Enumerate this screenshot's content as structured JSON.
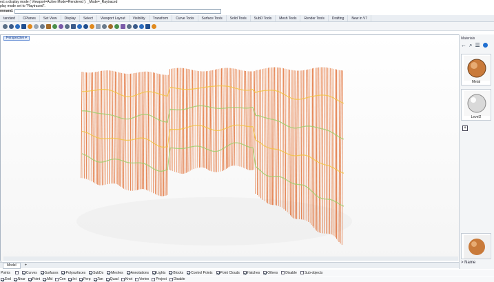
{
  "command_history": [
    "ect a display mode ( Viewport=Active  Mode=Rendered ): _Mode=_Raytraced",
    "play mode set to \"Raytraced\"."
  ],
  "command_prompt": "mmand:",
  "toolbar_tabs": [
    "tandard",
    "CPlanes",
    "Set View",
    "Display",
    "Select",
    "Viewport Layout",
    "Visibility",
    "Transform",
    "Curve Tools",
    "Surface Tools",
    "Solid Tools",
    "SubD Tools",
    "Mesh Tools",
    "Render Tools",
    "Drafting",
    "New in V7"
  ],
  "toolbar_icons": [
    "new-file-icon",
    "open-file-icon",
    "save-icon",
    "print-icon",
    "import-icon",
    "cut-icon",
    "copy-icon",
    "paste-icon",
    "undo-icon",
    "redo-icon",
    "pan-icon",
    "rotate-view-icon",
    "zoom-icon",
    "zoom-extents-icon",
    "zoom-window-icon",
    "camera-icon",
    "shade-icon",
    "render-icon",
    "sun-icon",
    "light-icon",
    "layer-icon",
    "material-icon",
    "display-icon",
    "osnap-icon",
    "options-icon"
  ],
  "viewport": {
    "label": "Perspective",
    "display_mode": "Raytraced",
    "colors": {
      "stroke_main": "#e0692d",
      "stroke_light": "#ec9a6c",
      "highlight_green": "#9bcf6a",
      "highlight_yellow": "#f2c441"
    }
  },
  "materials_panel": {
    "title": "Materials",
    "tools": [
      "back-arrow-icon",
      "search-icon",
      "list-view-icon",
      "help-icon"
    ],
    "items": [
      {
        "name": "Metal",
        "color": "#c97a3a"
      },
      {
        "name": "Level2",
        "color": "#d9d9d9"
      }
    ],
    "add_label": "+",
    "name_label": "> Name"
  },
  "model_tabs": [
    "Model",
    "+"
  ],
  "osnap_toggles": [
    {
      "label": "Points",
      "checked": false
    },
    {
      "label": "Curves",
      "checked": true
    },
    {
      "label": "Surfaces",
      "checked": true
    },
    {
      "label": "Polysurfaces",
      "checked": true
    },
    {
      "label": "SubDs",
      "checked": true
    },
    {
      "label": "Meshes",
      "checked": true
    },
    {
      "label": "Annotations",
      "checked": true
    },
    {
      "label": "Lights",
      "checked": true
    },
    {
      "label": "Blocks",
      "checked": true
    },
    {
      "label": "Control Points",
      "checked": true
    },
    {
      "label": "Point Clouds",
      "checked": true
    },
    {
      "label": "Hatches",
      "checked": true
    },
    {
      "label": "Others",
      "checked": true
    },
    {
      "label": "Disable",
      "checked": false
    },
    {
      "label": "Sub-objects",
      "checked": false
    }
  ],
  "snap_toggles": [
    {
      "label": "End",
      "checked": true
    },
    {
      "label": "Near",
      "checked": true
    },
    {
      "label": "Point",
      "checked": true
    },
    {
      "label": "Mid",
      "checked": true
    },
    {
      "label": "Cen",
      "checked": false
    },
    {
      "label": "Int",
      "checked": true
    },
    {
      "label": "Perp",
      "checked": true
    },
    {
      "label": "Tan",
      "checked": true
    },
    {
      "label": "Quad",
      "checked": true
    },
    {
      "label": "Knot",
      "checked": false
    },
    {
      "label": "Vertex",
      "checked": false
    },
    {
      "label": "Project",
      "checked": false
    },
    {
      "label": "Disable",
      "checked": false
    }
  ]
}
